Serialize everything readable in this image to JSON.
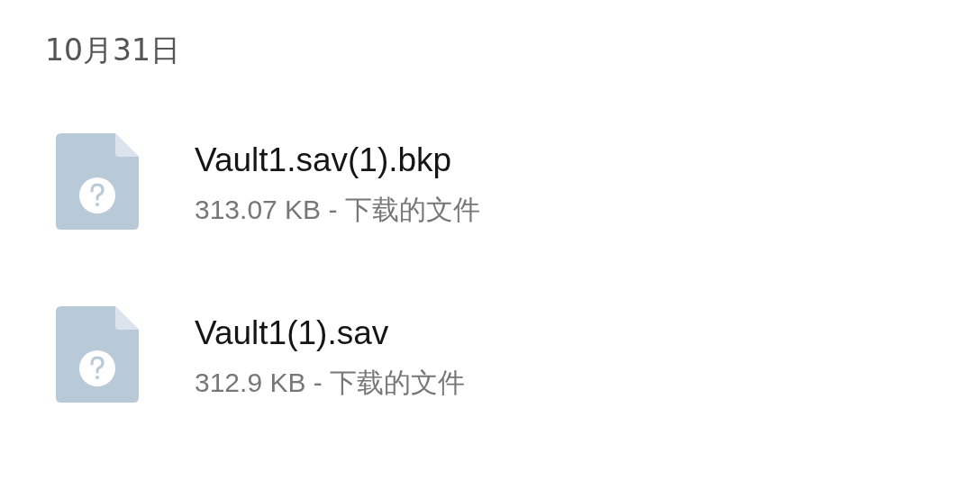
{
  "date_header": "10月31日",
  "files": [
    {
      "name": "Vault1.sav(1).bkp",
      "details": "313.07 KB - 下载的文件",
      "kind": "unknown"
    },
    {
      "name": "Vault1(1).sav",
      "details": "312.9 KB - 下载的文件",
      "kind": "unknown"
    }
  ]
}
